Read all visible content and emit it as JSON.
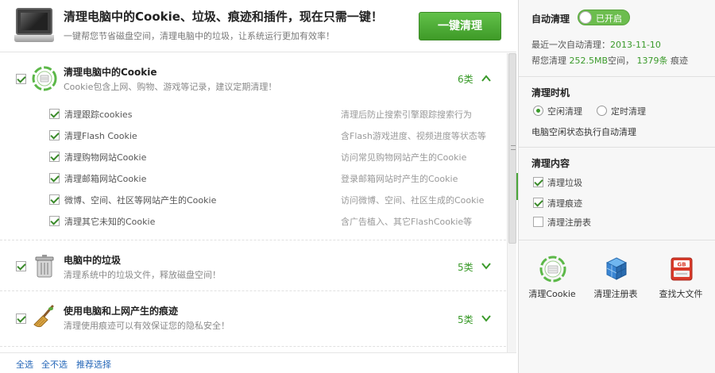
{
  "header": {
    "title": "清理电脑中的Cookie、垃圾、痕迹和插件，现在只需一键！",
    "subtitle": "一键帮您节省磁盘空间，清理电脑中的垃圾，让系统运行更加有效率！",
    "clean_button": "一键清理"
  },
  "sections": [
    {
      "title": "清理电脑中的Cookie",
      "desc": "Cookie包含上网、购物、游戏等记录，建议定期清理！",
      "count": "6类",
      "checked": true,
      "expanded": true,
      "icon": "cookie-icon",
      "items": [
        {
          "label": "清理跟踪cookies",
          "hint": "清理后防止搜索引擎跟踪搜索行为",
          "checked": true
        },
        {
          "label": "清理Flash Cookie",
          "hint": "含Flash游戏进度、视频进度等状态等",
          "checked": true
        },
        {
          "label": "清理购物网站Cookie",
          "hint": "访问常见购物网站产生的Cookie",
          "checked": true
        },
        {
          "label": "清理邮箱网站Cookie",
          "hint": "登录邮箱网站时产生的Cookie",
          "checked": true
        },
        {
          "label": "微博、空间、社区等网站产生的Cookie",
          "hint": "访问微博、空间、社区生成的Cookie",
          "checked": true
        },
        {
          "label": "清理其它未知的Cookie",
          "hint": "含广告植入、其它FlashCookie等",
          "checked": true
        }
      ]
    },
    {
      "title": "电脑中的垃圾",
      "desc": "清理系统中的垃圾文件，释放磁盘空间！",
      "count": "5类",
      "checked": true,
      "expanded": false,
      "icon": "trash-can-icon"
    },
    {
      "title": "使用电脑和上网产生的痕迹",
      "desc": "清理使用痕迹可以有效保证您的隐私安全！",
      "count": "5类",
      "checked": true,
      "expanded": false,
      "icon": "broom-icon"
    }
  ],
  "footer": {
    "select_all": "全选",
    "select_none": "全不选",
    "recommended": "推荐选择"
  },
  "right": {
    "auto_clean": {
      "label": "自动清理",
      "toggle_label": "已开启",
      "toggle_on": true,
      "last_label": "最近一次自动清理：",
      "last_date": "2013-11-10",
      "help_prefix": "帮您清理",
      "space": "252.5MB",
      "space_suffix": "空间，",
      "traces": "1379条",
      "traces_suffix": "痕迹"
    },
    "timing": {
      "label": "清理时机",
      "option_idle": "空闲清理",
      "option_scheduled": "定时清理",
      "selected": "option_idle",
      "note": "电脑空闲状态执行自动清理"
    },
    "content": {
      "label": "清理内容",
      "items": [
        {
          "label": "清理垃圾",
          "checked": true
        },
        {
          "label": "清理痕迹",
          "checked": true
        },
        {
          "label": "清理注册表",
          "checked": false
        }
      ]
    },
    "tools": [
      {
        "label": "清理Cookie",
        "icon": "cookie-icon"
      },
      {
        "label": "清理注册表",
        "icon": "registry-cubes-icon"
      },
      {
        "label": "查找大文件",
        "icon": "big-file-gb-icon"
      }
    ]
  },
  "colors": {
    "accent_green": "#3a9a2a",
    "button_green": "#4fad37",
    "link_blue": "#2466b8"
  }
}
